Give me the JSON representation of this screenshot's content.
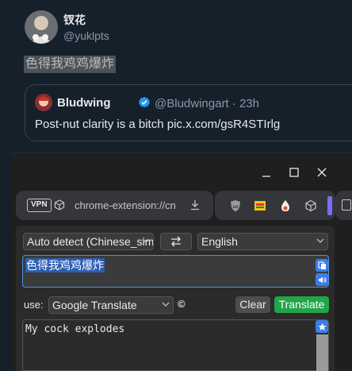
{
  "tweet": {
    "author_name": "钗花",
    "author_handle": "@yuklpts",
    "text": "色得我鸡鸡爆炸",
    "quote": {
      "author_name": "Bludwing",
      "author_handle": "@Bludwingart",
      "time": "· 23h",
      "text": "Post-nut clarity is a bitch pic.x.com/gsR4STIrlg"
    }
  },
  "popup": {
    "window_controls": {
      "minimize": "minimize-icon",
      "maximize": "maximize-icon",
      "close": "close-icon"
    },
    "address_bar": {
      "vpn_label": "VPN",
      "url": "chrome-extension://cn",
      "download_icon": "download-icon"
    },
    "extensions": [
      "ublock-icon",
      "yellow-extension-icon",
      "drop-extension-icon",
      "puzzle-cube-icon"
    ],
    "translator": {
      "source_language": "Auto detect (Chinese_simplified)",
      "target_language": "English",
      "source_text": "色得我鸡鸡爆炸",
      "use_label": "use:",
      "engine": "Google Translate",
      "copyright_symbol": "©",
      "clear_label": "Clear",
      "translate_label": "Translate",
      "result_text": "My cock explodes"
    }
  },
  "colors": {
    "accent_blue": "#3d7de8",
    "translate_green": "#22a449",
    "verified_blue": "#1d9bf0",
    "selection_blue": "#2c5fb4"
  }
}
